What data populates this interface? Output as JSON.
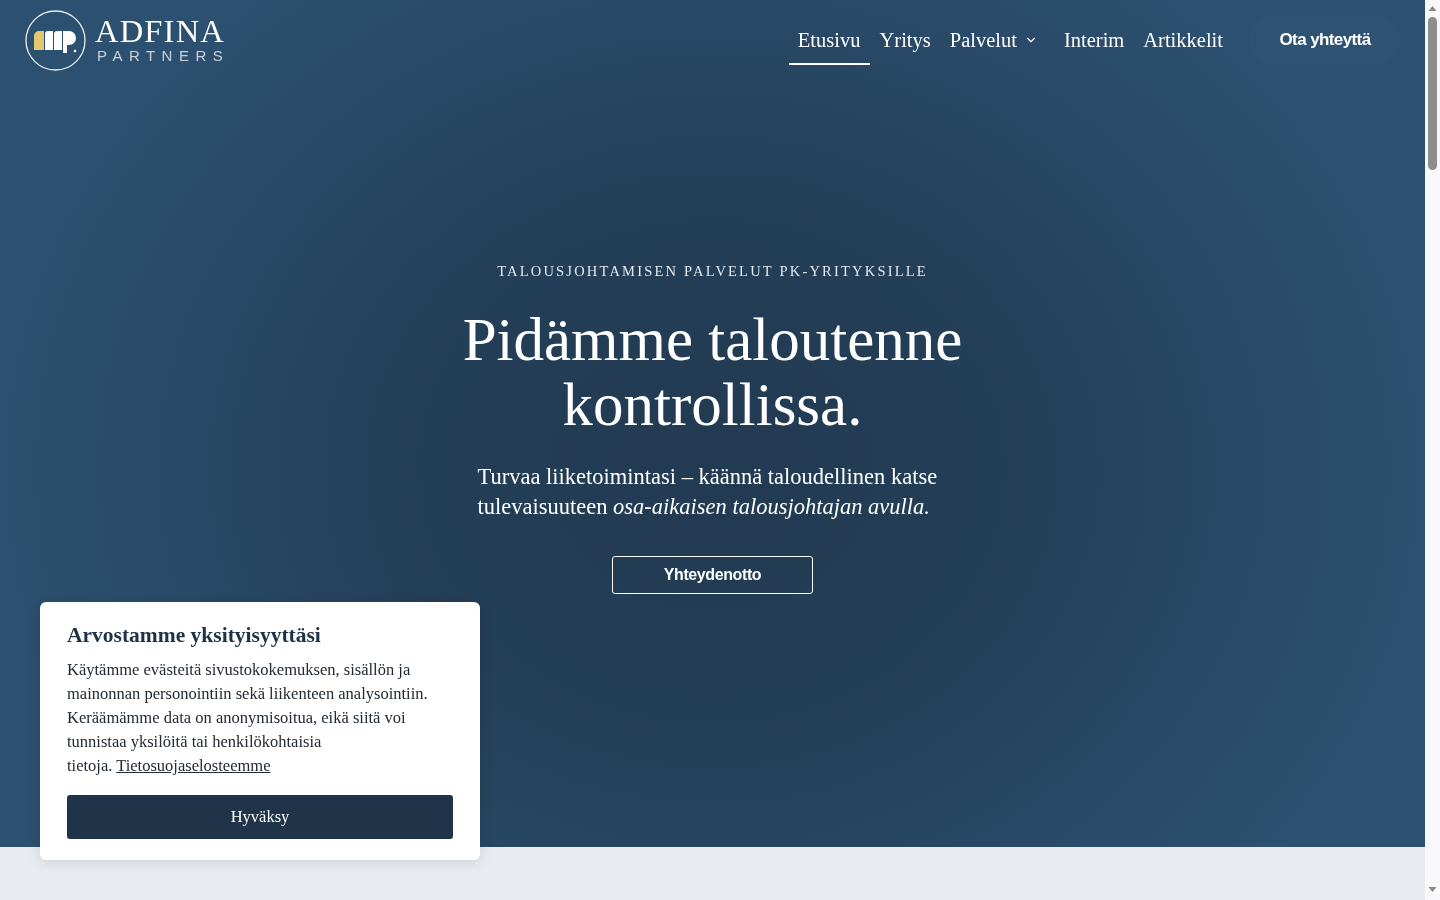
{
  "header": {
    "logo": {
      "name": "ADFINA",
      "tagline": "PARTNERS"
    },
    "nav": [
      {
        "label": "Etusivu",
        "selected": true,
        "kind": "link"
      },
      {
        "label": "Yritys",
        "selected": false,
        "kind": "link"
      },
      {
        "label": "Palvelut",
        "selected": false,
        "kind": "dropdown"
      },
      {
        "label": "Interim",
        "selected": false,
        "kind": "link"
      },
      {
        "label": "Artikkelit",
        "selected": false,
        "kind": "link"
      }
    ],
    "cta": "Ota yhteyttä"
  },
  "hero": {
    "eyebrow": "TALOUSJOHTAMISEN PALVELUT PK-YRITYKSILLE",
    "heading": "Pidämme taloutenne kontrollissa.",
    "lead": "Turvaa liiketoimintasi – käännä taloudellinen katse tulevaisuuteen *osa-aikaisen talousjohtajan avulla.*",
    "button": "Yhteydenotto"
  },
  "cookie_banner": {
    "title": "Arvostamme yksityisyyttäsi",
    "text": "Käytämme evästeitä sivustokokemuksen, sisällön ja mainonnan personointiin sekä liikenteen analysointiin. Keräämämme data on anonymisoitua, eikä siitä voi tunnistaa yksilöitä tai henkilökohtaisia tietoja.",
    "link": "Tietosuojaselosteemme",
    "button": "Hyväksy"
  }
}
